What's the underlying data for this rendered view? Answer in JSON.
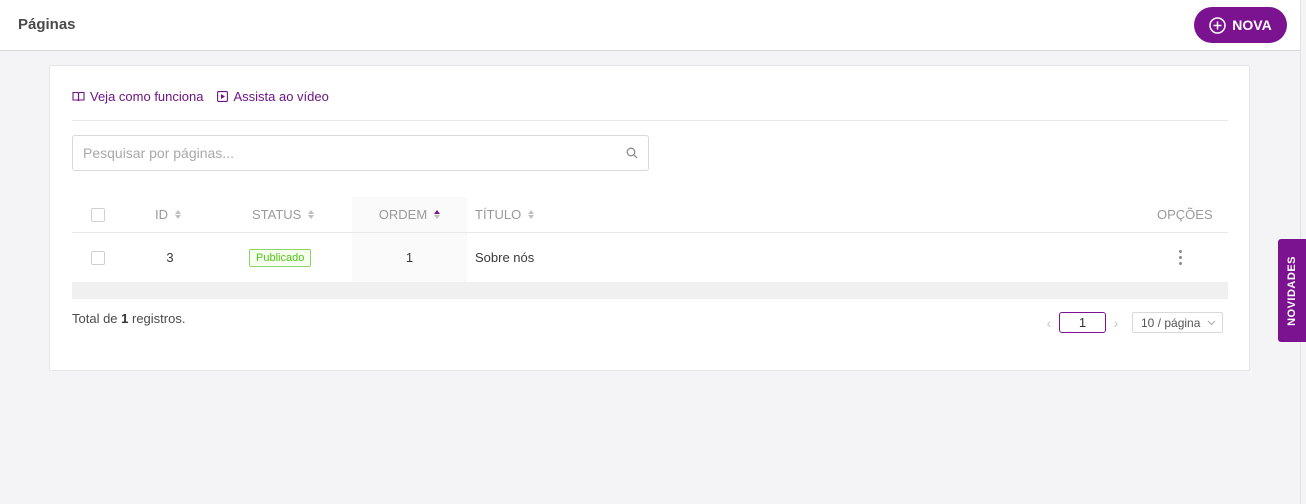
{
  "header": {
    "title": "Páginas",
    "new_label": "NOVA"
  },
  "help": {
    "how_it_works": "Veja como funciona",
    "watch_video": "Assista ao vídeo"
  },
  "search": {
    "placeholder": "Pesquisar por páginas..."
  },
  "table": {
    "columns": {
      "id": "ID",
      "status": "STATUS",
      "order": "ORDEM",
      "title": "TÍTULO",
      "options": "OPÇÕES"
    },
    "rows": [
      {
        "id": "3",
        "status": "Publicado",
        "order": "1",
        "title": "Sobre nós"
      }
    ]
  },
  "footer": {
    "total_prefix": "Total de ",
    "total_count": "1",
    "total_suffix": " registros."
  },
  "pagination": {
    "current_page": "1",
    "page_size": "10 / página"
  },
  "side_tab": {
    "label": "NOVIDADES"
  },
  "colors": {
    "accent": "#7b1391",
    "badge_green": "#52c41a",
    "background": "#f4f4f7"
  }
}
